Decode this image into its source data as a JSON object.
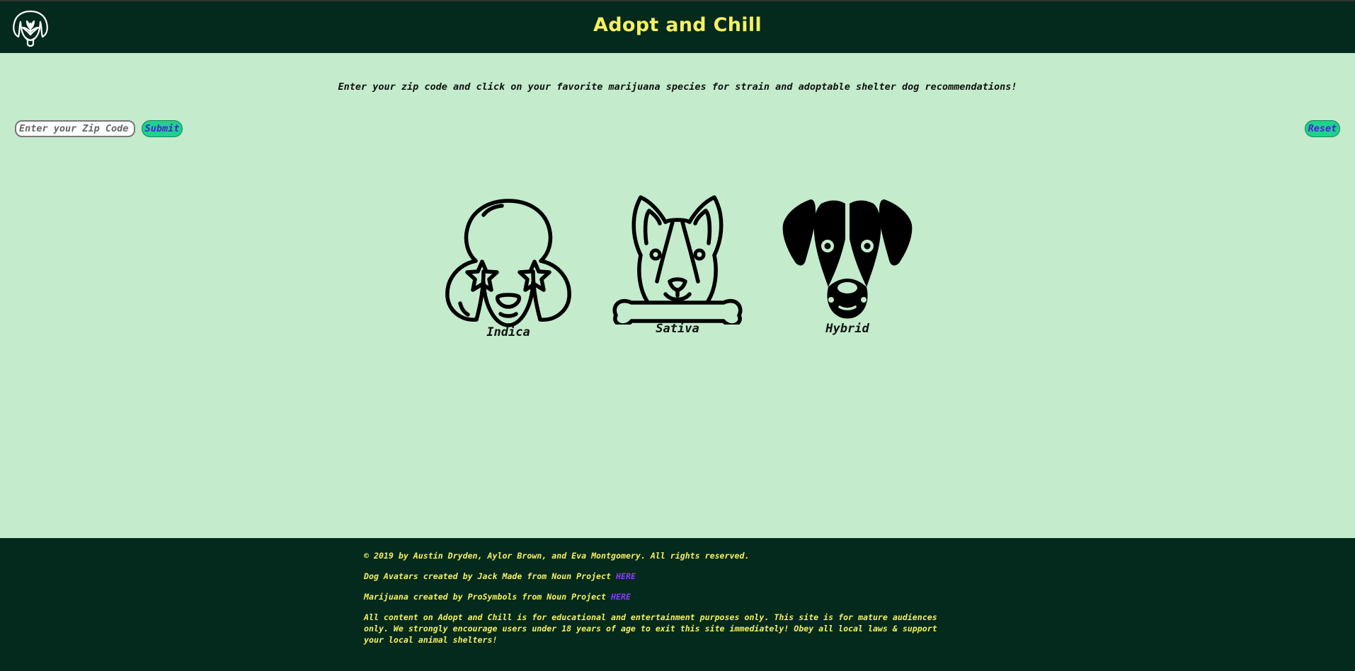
{
  "header": {
    "title": "Adopt and Chill",
    "logo_icon": "dog-cannabis-logo-icon"
  },
  "main": {
    "instructions": "Enter your zip code and click on your favorite marijuana species for strain and adoptable shelter dog recommendations!",
    "zip_input": {
      "placeholder": "Enter your Zip Code",
      "value": ""
    },
    "submit_label": "Submit",
    "reset_label": "Reset",
    "dogs": [
      {
        "label": "Indica",
        "icon": "poodle-star-eyes-icon"
      },
      {
        "label": "Sativa",
        "icon": "corgi-with-bone-icon"
      },
      {
        "label": "Hybrid",
        "icon": "spotted-dog-icon"
      }
    ]
  },
  "footer": {
    "copyright": "© 2019 by Austin Dryden, Aylor Brown, and Eva Montgomery. All rights reserved.",
    "credit_avatars": "Dog Avatars created by Jack Made from Noun Project",
    "credit_avatars_link": "HERE",
    "credit_marijuana": "Marijuana created by ProSymbols from Noun Project",
    "credit_marijuana_link": "HERE",
    "disclaimer": "All content on Adopt and Chill is for educational and entertainment purposes only. This site is for mature audiences only. We strongly encourage users under 18 years of age to exit this site immediately! Obey all local laws & support your local animal shelters!"
  },
  "colors": {
    "background": "#c3ebcc",
    "header_footer": "#042a1d",
    "title_yellow": "#f6f061",
    "button_green": "#1fd08f",
    "button_text": "#4b1fd6",
    "link_purple": "#8b3bf1"
  }
}
